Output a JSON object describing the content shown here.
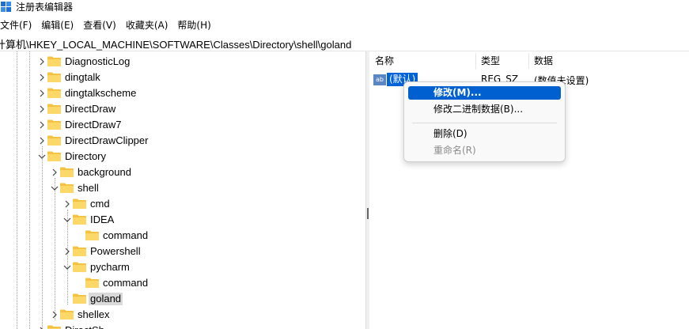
{
  "window": {
    "title": "注册表编辑器"
  },
  "menu": [
    "文件(F)",
    "编辑(E)",
    "查看(V)",
    "收藏夹(A)",
    "帮助(H)"
  ],
  "address": "计算机\\HKEY_LOCAL_MACHINE\\SOFTWARE\\Classes\\Directory\\shell\\goland",
  "tree": {
    "items": [
      {
        "label": "DiagnosticLog",
        "expander": "right",
        "selected": false
      },
      {
        "label": "dingtalk",
        "expander": "right",
        "selected": false
      },
      {
        "label": "dingtalkscheme",
        "expander": "right",
        "selected": false
      },
      {
        "label": "DirectDraw",
        "expander": "right",
        "selected": false
      },
      {
        "label": "DirectDraw7",
        "expander": "right",
        "selected": false
      },
      {
        "label": "DirectDrawClipper",
        "expander": "right",
        "selected": false
      },
      {
        "label": "Directory",
        "expander": "down",
        "selected": false
      },
      {
        "label": "background",
        "expander": "right",
        "selected": false
      },
      {
        "label": "shell",
        "expander": "down",
        "selected": false
      },
      {
        "label": "cmd",
        "expander": "right",
        "selected": false
      },
      {
        "label": "IDEA",
        "expander": "down",
        "selected": false
      },
      {
        "label": "command",
        "expander": "none",
        "selected": false
      },
      {
        "label": "Powershell",
        "expander": "right",
        "selected": false
      },
      {
        "label": "pycharm",
        "expander": "down",
        "selected": false
      },
      {
        "label": "command",
        "expander": "none",
        "selected": false
      },
      {
        "label": "goland",
        "expander": "none",
        "selected": true
      },
      {
        "label": "shellex",
        "expander": "right",
        "selected": false
      },
      {
        "label": "DirectSh",
        "expander": "right",
        "selected": false
      }
    ]
  },
  "values_pane": {
    "columns": {
      "name": "名称",
      "type": "类型",
      "data": "数据"
    },
    "rows": [
      {
        "icon": "ab",
        "name": "(默认)",
        "type": "REG_SZ",
        "data": "(数值未设置)"
      }
    ]
  },
  "context_menu": {
    "items": [
      {
        "label": "修改(M)...",
        "state": "highlighted"
      },
      {
        "label": "修改二进制数据(B)...",
        "state": "normal"
      },
      {
        "label": "删除(D)",
        "state": "normal"
      },
      {
        "label": "重命名(R)",
        "state": "disabled"
      }
    ]
  },
  "colors": {
    "selection": "#0063d8",
    "menu_highlight": "#0060d0",
    "folder": "#f5c342",
    "tree_selected_bg": "#d9d9d9"
  }
}
